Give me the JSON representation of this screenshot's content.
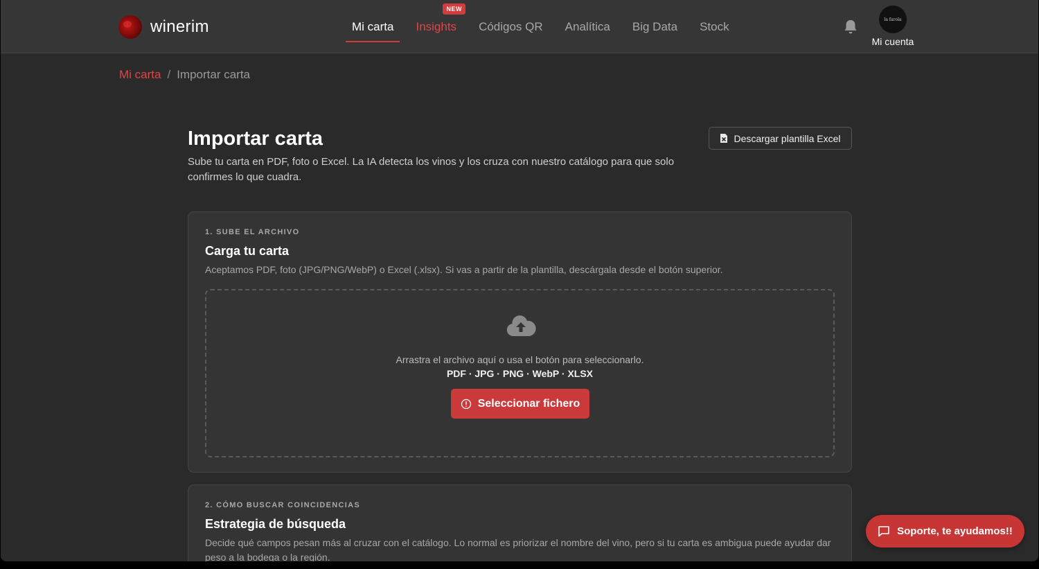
{
  "brand": {
    "name": "winerim"
  },
  "nav": {
    "items": [
      {
        "label": "Mi carta"
      },
      {
        "label": "Insights",
        "badge": "NEW"
      },
      {
        "label": "Códigos QR"
      },
      {
        "label": "Analítica"
      },
      {
        "label": "Big Data"
      },
      {
        "label": "Stock"
      }
    ],
    "active": "Mi carta"
  },
  "account": {
    "label": "Mi cuenta",
    "avatar_text": "la farola"
  },
  "breadcrumb": {
    "parent": "Mi carta",
    "separator": "/",
    "current": "Importar carta"
  },
  "page": {
    "title": "Importar carta",
    "description": "Sube tu carta en PDF, foto o Excel. La IA detecta los vinos y los cruza con nuestro catálogo para que solo confirmes lo que cuadra.",
    "download_button": "Descargar plantilla Excel"
  },
  "upload_card": {
    "step": "1. SUBE EL ARCHIVO",
    "title": "Carga tu carta",
    "description": "Aceptamos PDF, foto (JPG/PNG/WebP) o Excel (.xlsx). Si vas a partir de la plantilla, descárgala desde el botón superior.",
    "dropzone_text": "Arrastra el archivo aquí o usa el botón para seleccionarlo.",
    "formats": "PDF · JPG · PNG · WebP · XLSX",
    "select_button": "Seleccionar fichero"
  },
  "strategy_card": {
    "step": "2. CÓMO BUSCAR COINCIDENCIAS",
    "title": "Estrategia de búsqueda",
    "description": "Decide qué campos pesan más al cruzar con el catálogo. Lo normal es priorizar el nombre del vino, pero si tu carta es ambigua puede ayudar dar peso a la bodega o la región."
  },
  "support": {
    "label": "Soporte, te ayudamos!!"
  },
  "colors": {
    "accent": "#cb3a3a",
    "background": "#2a2a2a",
    "header": "#363636"
  }
}
